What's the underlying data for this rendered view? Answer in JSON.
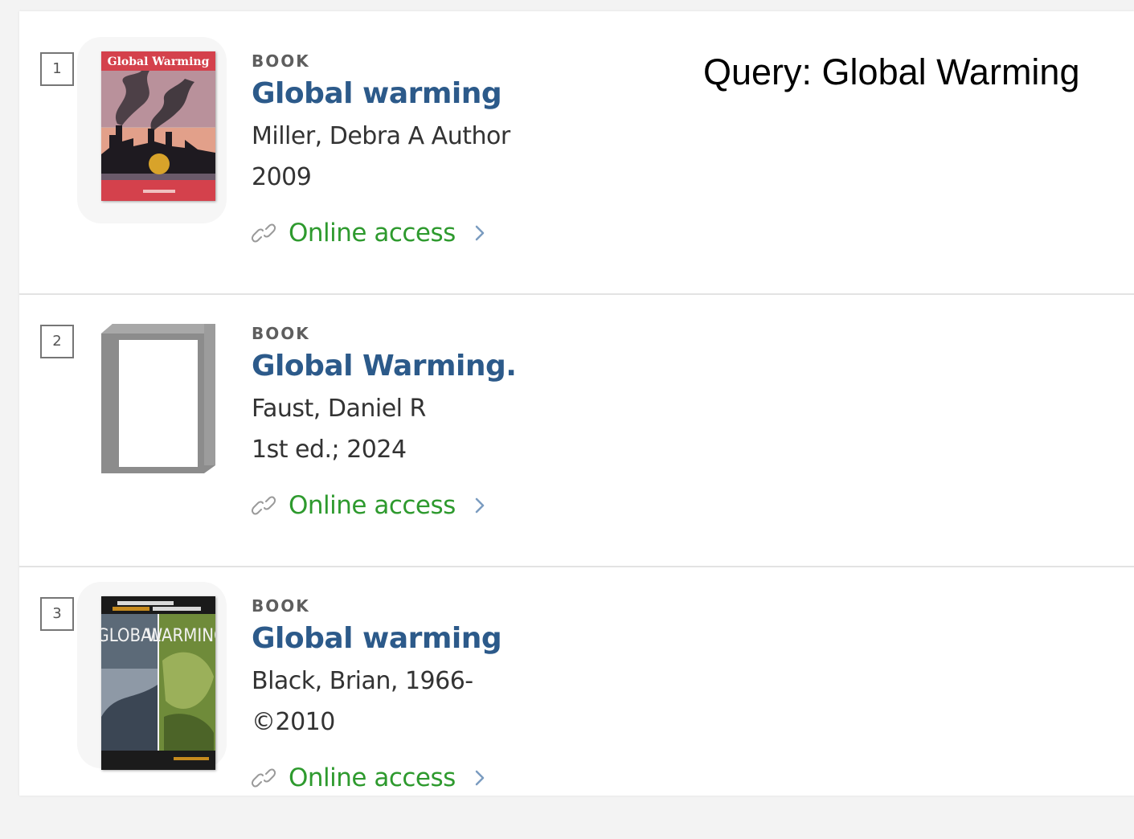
{
  "query_label": "Query: Global Warming",
  "results": [
    {
      "index": "1",
      "type": "BOOK",
      "title": "Global warming",
      "author": "Miller, Debra A Author",
      "date": "2009",
      "access_label": "Online access",
      "cover_text": "Global Warming"
    },
    {
      "index": "2",
      "type": "BOOK",
      "title": "Global Warming.",
      "author": "Faust, Daniel R",
      "date": "1st ed.; 2024",
      "access_label": "Online access"
    },
    {
      "index": "3",
      "type": "BOOK",
      "title": "Global warming",
      "author": "Black, Brian, 1966-",
      "date": "©2010",
      "access_label": "Online access",
      "cover_text_left": "GLOBAL",
      "cover_text_right": "WARMING"
    }
  ],
  "colors": {
    "title": "#2c5a8a",
    "access": "#2e9a2e",
    "type": "#5e5e5e"
  }
}
